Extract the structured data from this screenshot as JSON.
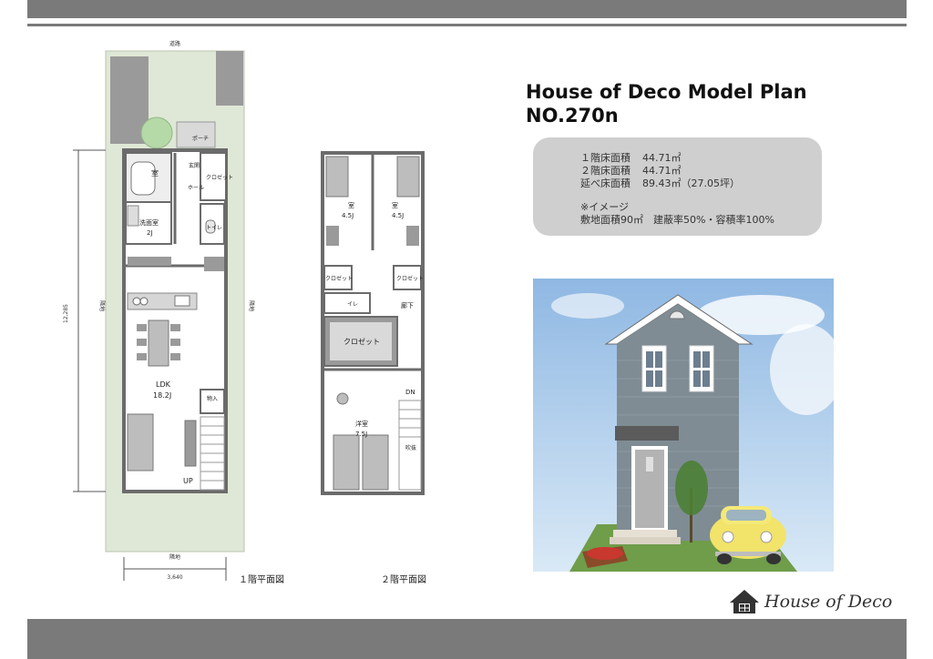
{
  "header": {
    "title_line1": "House of Deco Model Plan",
    "title_line2": "NO.270n"
  },
  "areas": {
    "floor1": {
      "label": "１階床面積",
      "value": "44.71㎡"
    },
    "floor2": {
      "label": "２階床面積",
      "value": "44.71㎡"
    },
    "total": {
      "label": "延べ床面積",
      "value": "89.43㎡（27.05坪）"
    },
    "image_note": "※イメージ",
    "site_note": "敷地面積90㎡　建蔽率50%・容積率100%"
  },
  "plan1": {
    "road": "道路",
    "neighbor_left": "隣地",
    "neighbor_right": "隣地",
    "neighbor_bottom": "隣地",
    "dim_vertical": "12,285",
    "dim_horizontal": "3,640",
    "caption": "１階平面図",
    "rooms": {
      "porch": "ポーチ",
      "bath": "室",
      "genkan": "玄関",
      "closet": "クロゼット",
      "hall": "ホール",
      "washroom": "洗面室",
      "washroom_size": "2J",
      "toilet": "トイレ",
      "ldk": "LDK",
      "ldk_size": "18.2J",
      "storage": "物入",
      "up": "UP"
    }
  },
  "plan2": {
    "caption": "２階平面図",
    "rooms": {
      "room_a": "室",
      "room_a_size": "4.5J",
      "room_b": "室",
      "room_b_size": "4.5J",
      "closet_l": "クロゼット",
      "closet_r": "クロゼット",
      "toilet": "イレ",
      "corridor": "廊下",
      "closet_center": "クロゼット",
      "dn": "DN",
      "western": "洋室",
      "western_size": "7.5J",
      "void": "吹抜"
    }
  },
  "logo": {
    "text": "House of Deco"
  },
  "colors": {
    "band": "#7a7a7a",
    "info_bg": "#cfcfcf",
    "lawn": "#dfe8d6",
    "wall": "#6b6b6b",
    "siding": "#7f8c94"
  }
}
